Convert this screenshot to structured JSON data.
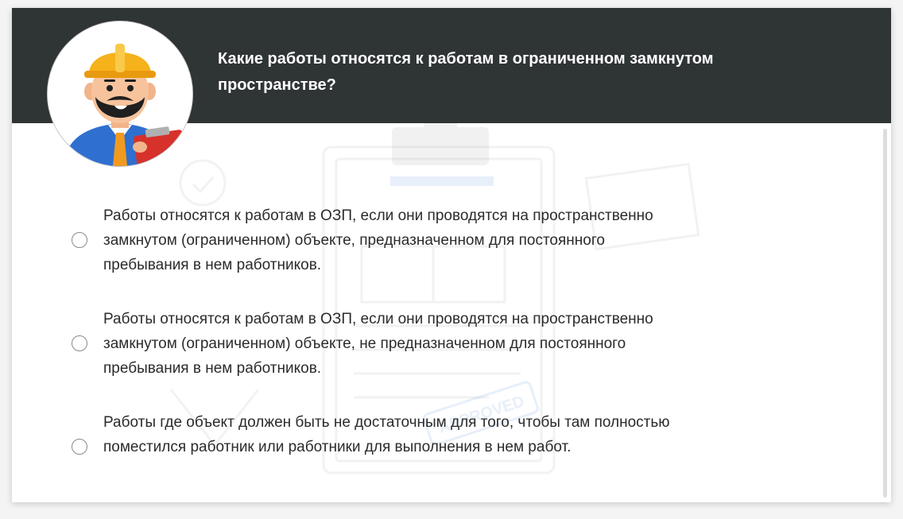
{
  "question": {
    "text": "Какие работы относятся к работам в ограниченном замкнутом пространстве?"
  },
  "avatar": {
    "icon": "worker-avatar-icon"
  },
  "background": {
    "stamp_text": "APPROVED"
  },
  "options": [
    {
      "text": "Работы относятся к работам в ОЗП, если они проводятся на пространственно замкнутом (ограниченном) объекте, предназначенном для постоянного пребывания в нем работников.",
      "selected": false
    },
    {
      "text": "Работы относятся к работам в ОЗП, если они проводятся на пространственно замкнутом (ограниченном) объекте, не предназначенном для постоянного пребывания в нем работников.",
      "selected": false
    },
    {
      "text": "Работы где объект должен быть не достаточным для того, чтобы там полностью поместился работник или работники для выполнения в нем работ.",
      "selected": false
    }
  ],
  "colors": {
    "header_bg": "#2f3435",
    "header_text": "#ffffff",
    "body_text": "#2b2b2b",
    "helmet": "#f6b21b",
    "jacket": "#2f6fd0",
    "clipboard": "#d6312b"
  }
}
